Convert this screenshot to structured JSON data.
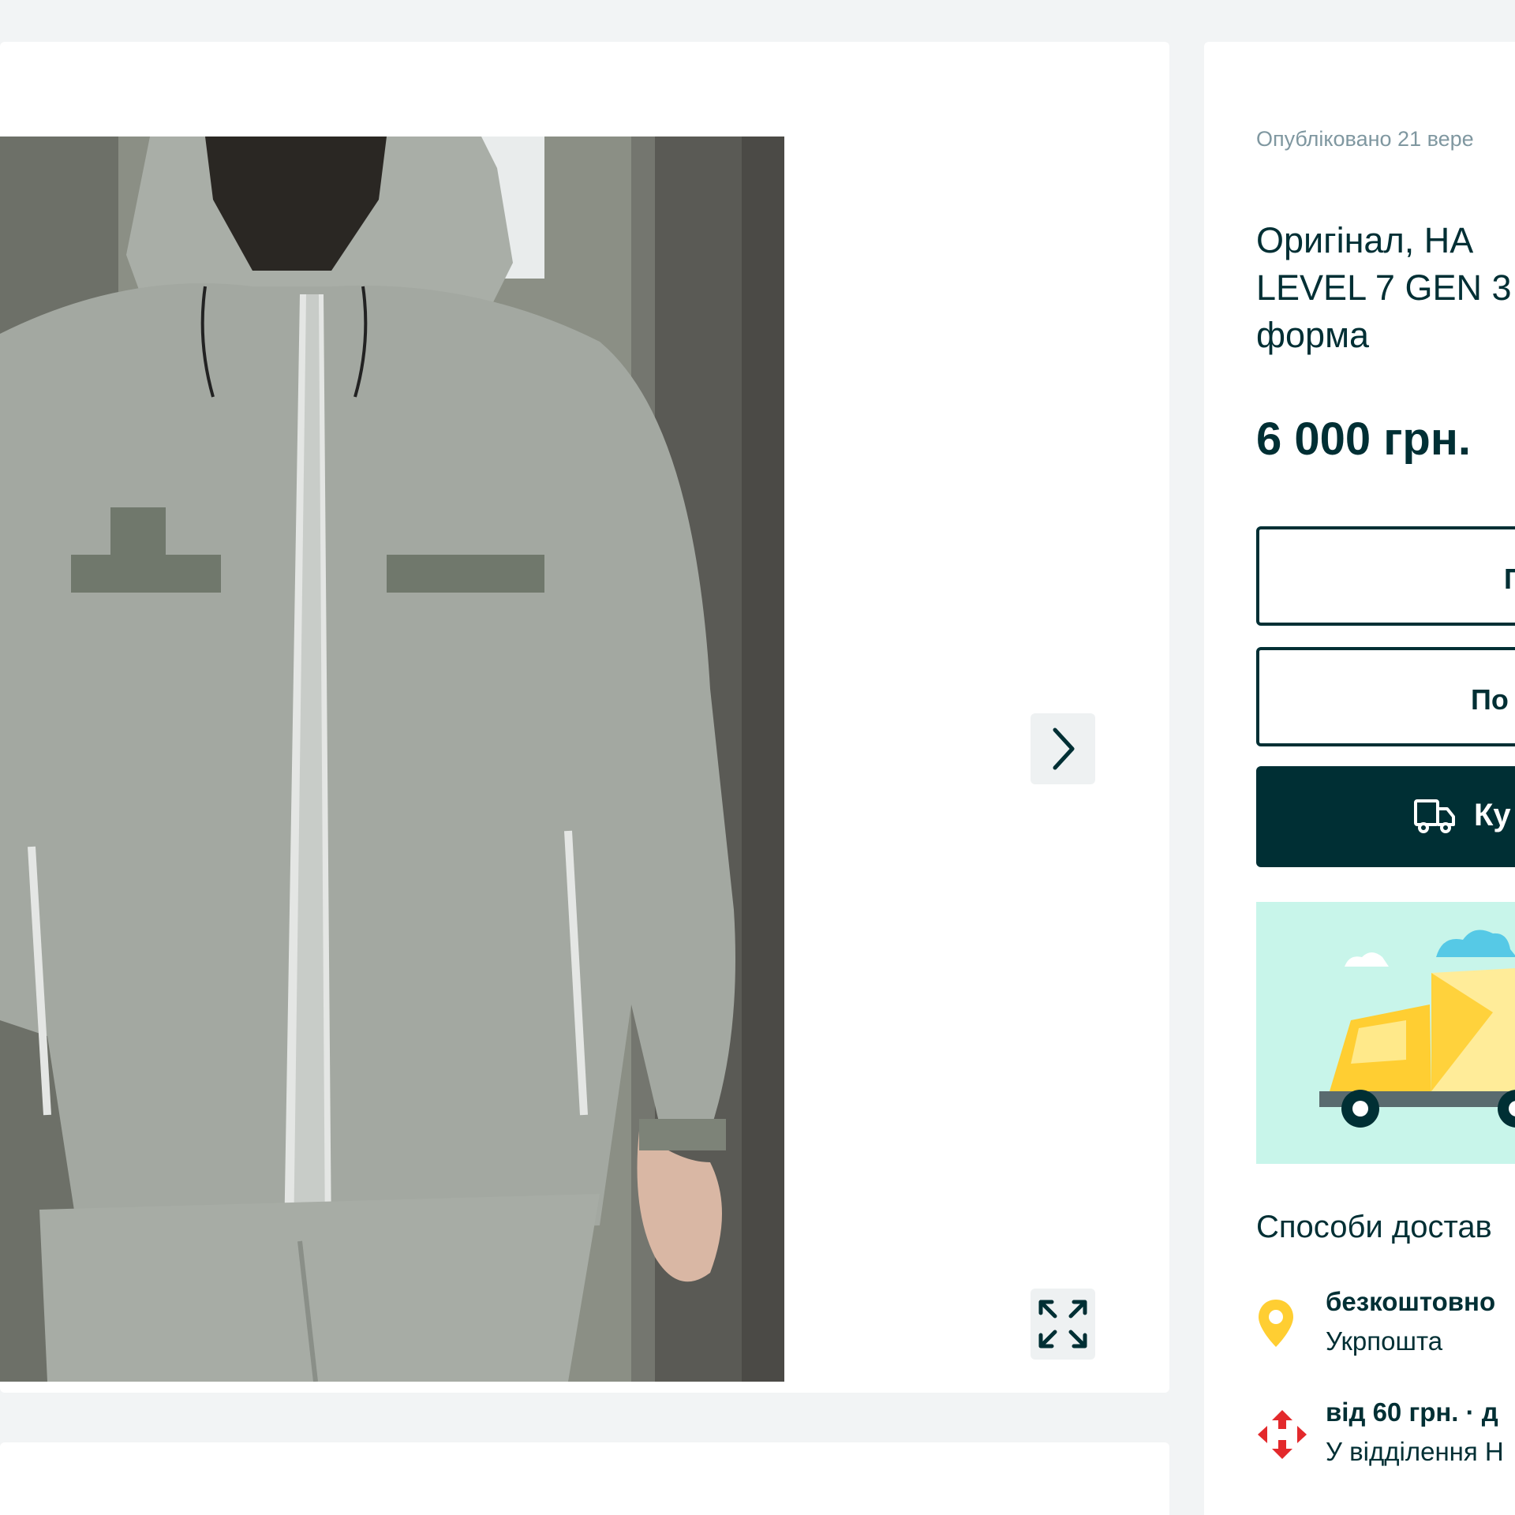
{
  "listing": {
    "published": "Опубліковано 21 вере",
    "title_line1": "Оригінал, НА",
    "title_line2": "LEVEL 7 GEN 3",
    "title_line3": "форма",
    "price": "6 000 грн. "
  },
  "actions": {
    "button1_label": "П",
    "button2_label": "По",
    "buy_label": "Ку"
  },
  "delivery": {
    "heading": "Способи достав",
    "options": [
      {
        "icon": "location-pin-icon",
        "main": "безкоштовно",
        "sub": "Укрпошта"
      },
      {
        "icon": "nova-poshta-icon",
        "main": "від 60 грн. · д",
        "sub": "У відділення Н"
      }
    ]
  },
  "colors": {
    "brand_dark": "#002f34",
    "background": "#f2f4f5",
    "promo_bg": "#c8f5ea",
    "truck_yellow": "#ffce32",
    "pin_yellow": "#ffce32",
    "nova_red": "#e3292c"
  }
}
